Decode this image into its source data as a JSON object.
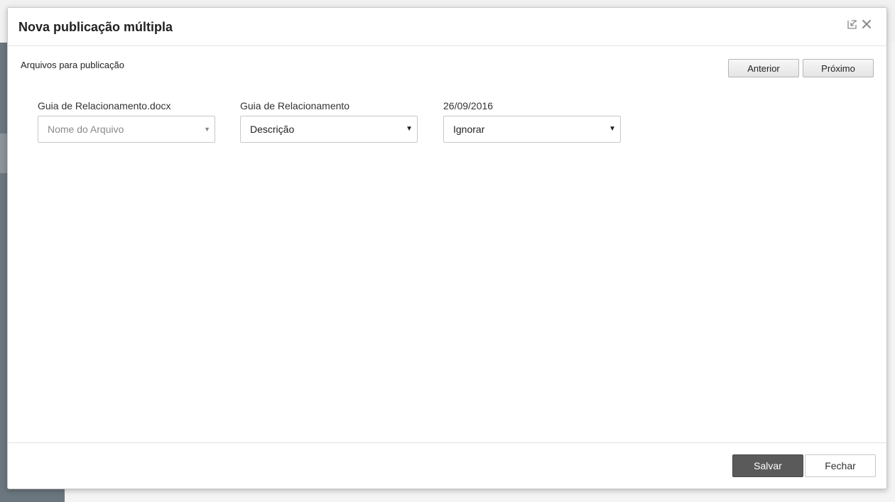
{
  "modal": {
    "title": "Nova publicação múltipla",
    "section_label": "Arquivos para publicação",
    "nav": {
      "prev_label": "Anterior",
      "next_label": "Próximo"
    },
    "fields": [
      {
        "label": "Guia de Relacionamento.docx",
        "selected": "Nome do Arquivo",
        "is_placeholder": true
      },
      {
        "label": "Guia de Relacionamento",
        "selected": "Descrição",
        "is_placeholder": false
      },
      {
        "label": "26/09/2016",
        "selected": "Ignorar",
        "is_placeholder": false
      }
    ],
    "footer": {
      "save_label": "Salvar",
      "close_label": "Fechar"
    },
    "icons": {
      "restore": "restore-icon",
      "close": "close-icon"
    }
  },
  "colors": {
    "save_button_bg": "#5a5a5a",
    "sidebar_bg": "#6b767e"
  }
}
